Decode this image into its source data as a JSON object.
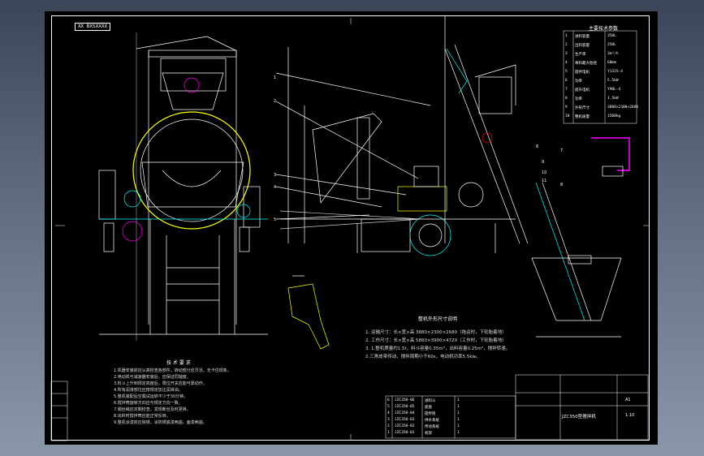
{
  "window": {
    "tag_text": "XX BXSXXXX"
  },
  "drawing": {
    "tech_requirements_title": "技 术 要 求",
    "tech_requirements": [
      "1.机器安装前应认真检查各部件，转动部分应灵活，无卡住现象。",
      "2.电动机与减速器安装后，应保证同轴度。",
      "3.料斗上升到规定高度后，限位开关应能可靠动作。",
      "4.所有润滑部位应按规定加注润滑油。",
      "5.整机装配后空载试运转不少于30分钟。",
      "6.搅拌筒旋转方向应与规定方向一致。",
      "7.钢丝绳应定期检查，发现断丝及时更换。",
      "8.出料时搅拌筒应能正常反转。",
      "9.整机涂漆前应除锈，涂防锈底漆两遍，面漆两遍。"
    ],
    "install_title": "整机外形尺寸说明",
    "install_notes": [
      "1. 运输尺寸：长×宽×高 3880×2300×2680（拖运时，下轮胎着地）",
      "2. 工作尺寸：长×宽×高 5860×3900×4720（工作时，下轮胎着地）",
      "3. 1.整机质量约1.5t，料斗容量0.35m³，出料容量0.25m³，搅拌转速。",
      "   2.三角皮带传动，搅拌周期小于60s，电动机功率5.5kw。"
    ],
    "params_title": "主要技术参数",
    "params": [
      [
        "1",
        "进料容量",
        "350L"
      ],
      [
        "2",
        "出料容量",
        "250L"
      ],
      [
        "3",
        "生产率",
        "3m³/h"
      ],
      [
        "4",
        "骨料最大粒径",
        "60mm"
      ],
      [
        "5",
        "搅拌电机",
        "Y132S-4"
      ],
      [
        "6",
        "功率",
        "5.5kW"
      ],
      [
        "7",
        "提升电机",
        "Y90L-4"
      ],
      [
        "8",
        "功率",
        "1.5kW"
      ],
      [
        "9",
        "外形尺寸",
        "3880×2300×2680"
      ],
      [
        "10",
        "整机质量",
        "1500kg"
      ]
    ],
    "title_block": {
      "name": "JZC350型搅拌机",
      "scale": "1:10",
      "sheet": "A1"
    },
    "bom": [
      [
        "6",
        "JZC350-06",
        "进料斗",
        "1"
      ],
      [
        "5",
        "JZC350-05",
        "底盘",
        "1"
      ],
      [
        "4",
        "JZC350-04",
        "搅拌筒",
        "1"
      ],
      [
        "3",
        "JZC350-03",
        "供水系统",
        "1"
      ],
      [
        "2",
        "JZC350-02",
        "传动系统",
        "1"
      ],
      [
        "1",
        "JZC350-01",
        "机架",
        "1"
      ]
    ],
    "callouts": [
      "1",
      "2",
      "3",
      "4",
      "5",
      "6",
      "7",
      "8",
      "9",
      "10",
      "11"
    ]
  }
}
